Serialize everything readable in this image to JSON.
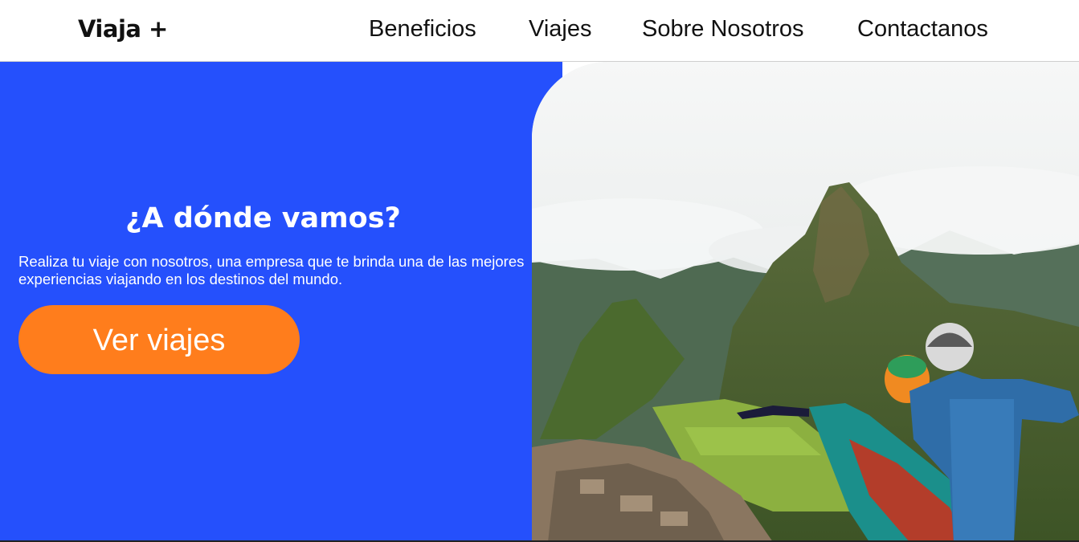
{
  "header": {
    "logo": "Viaja +",
    "nav": [
      "Beneficios",
      "Viajes",
      "Sobre Nosotros",
      "Contactanos"
    ]
  },
  "hero": {
    "title": "¿A dónde vamos?",
    "text": "Realiza tu viaje con nosotros, una empresa que te brinda una de las mejores experiencias viajando en los destinos del mundo.",
    "cta": "Ver viajes"
  },
  "colors": {
    "hero_background": "#2550fc",
    "cta_background": "#ff7d1c",
    "text_light": "#ffffff",
    "text_dark": "#111111"
  },
  "icons": {
    "hero_image": "mountain-ruins-travelers-photo"
  }
}
